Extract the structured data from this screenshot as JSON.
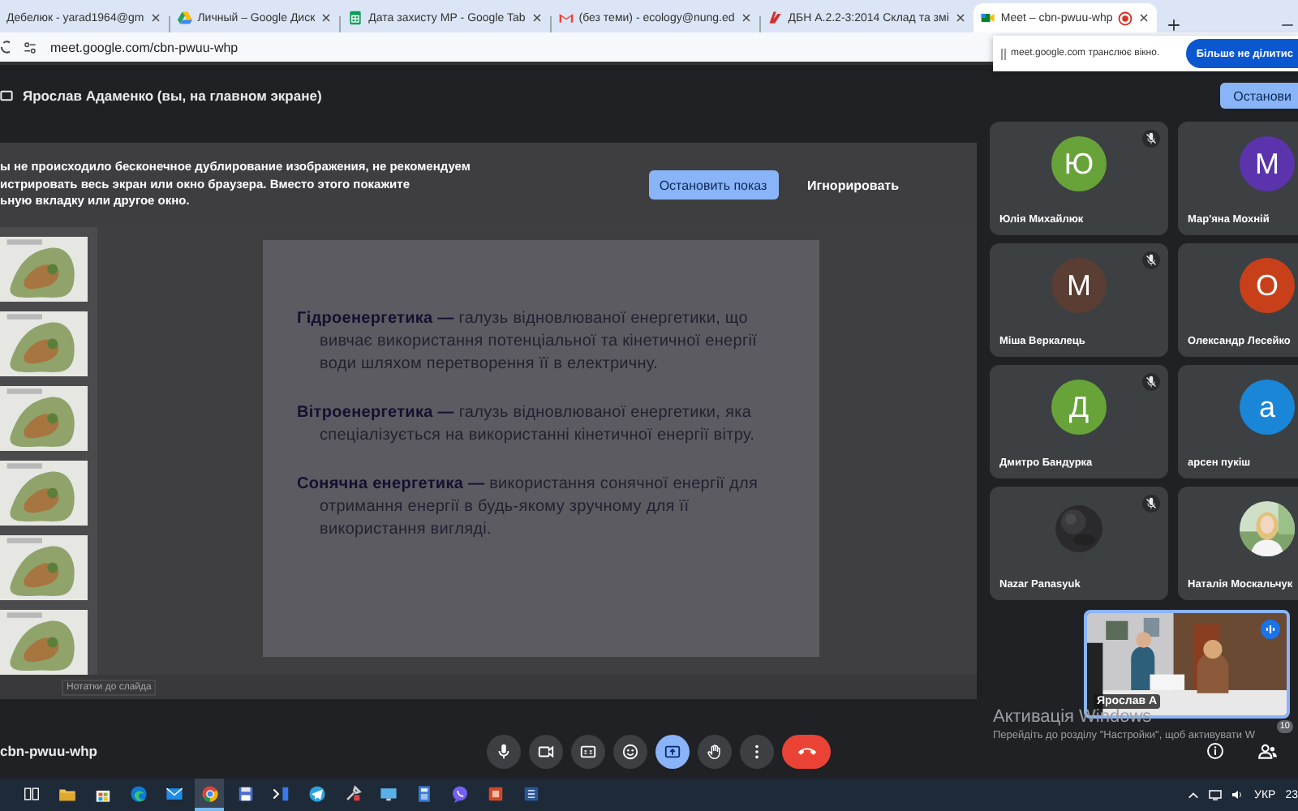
{
  "tabs": [
    {
      "title": "Дебелюк - yarad1964@gm",
      "kind": "plain",
      "selected": false
    },
    {
      "title": "Личный – Google Диск",
      "kind": "drive",
      "selected": false
    },
    {
      "title": "Дата захисту МР - Google Tab",
      "kind": "sheets",
      "selected": false
    },
    {
      "title": "(без теми) - ecology@nung.ed",
      "kind": "mail",
      "selected": false
    },
    {
      "title": "ДБН А.2.2-3:2014 Склад та змі",
      "kind": "emblem",
      "selected": false
    },
    {
      "title": "Meet – cbn-pwuu-whp",
      "kind": "meet",
      "selected": true,
      "recording": true
    }
  ],
  "address": {
    "url": "meet.google.com/cbn-pwuu-whp"
  },
  "share_popup": {
    "text": "meet.google.com транслює вікно.",
    "button": "Більше не ділитис"
  },
  "meet_header": {
    "presenter": "Ярослав Адаменко (вы, на главном экране)",
    "stop_button": "Останови"
  },
  "presentation": {
    "notice": {
      "text": "ы не происходило бесконечное дублирование изображения, не рекомендуем\nистрировать весь экран или окно браузера. Вместо этого покажите\nьную вкладку или другое окно.",
      "primary": "Остановить показ",
      "secondary": "Игнорировать"
    },
    "slide": {
      "paragraphs": [
        "**Гідроенергетика —** галузь відновлюваної енергетики, що вивчає використання потенціальної та кінетичної енергії води шляхом перетворення її в електричну.",
        "**Вітроенергетика —** галузь відновлюваної енергетики, яка спеціалізується на використанні кінетичної енергії вітру.",
        "**Сонячна енергетика —** використання сонячної енергії для отримання енергії в будь-якому зручному для її використання вигляді."
      ]
    },
    "notes": "Нотатки до слайда"
  },
  "participants": [
    {
      "name": "Юлія Михайлюк",
      "kind": "letter",
      "initial": "Ю",
      "color": "#68a33a",
      "muted": true
    },
    {
      "name": "Мар'яна Мохній",
      "kind": "letter",
      "initial": "М",
      "color": "#5b34ad"
    },
    {
      "name": "Міша Веркалець",
      "kind": "letter",
      "initial": "М",
      "color": "#5a3d33",
      "muted": true
    },
    {
      "name": "Олександр Лесейко",
      "kind": "letter",
      "initial": "О",
      "color": "#c8401a"
    },
    {
      "name": "Дмитро Бандурка",
      "kind": "letter",
      "initial": "Д",
      "color": "#68a33a",
      "muted": true
    },
    {
      "name": "арсен пукіш",
      "kind": "letter",
      "initial": "а",
      "color": "#1a86d8"
    },
    {
      "name": "Nazar Panasyuk",
      "kind": "picture",
      "muted": true
    },
    {
      "name": "Наталія Москальчук",
      "kind": "picture"
    }
  ],
  "self_view": {
    "name": "Ярослав А",
    "speaking": true
  },
  "meeting_code": "cbn-pwuu-whp",
  "controls": [
    {
      "kind": "mic",
      "selected": false
    },
    {
      "kind": "camera",
      "selected": false
    },
    {
      "kind": "captions",
      "selected": false
    },
    {
      "kind": "emoji",
      "selected": false
    },
    {
      "kind": "present",
      "selected": true
    },
    {
      "kind": "hand",
      "selected": false
    },
    {
      "kind": "more",
      "selected": false
    },
    {
      "kind": "leave",
      "selected": false
    }
  ],
  "participant_count": "10",
  "windows_notice": {
    "title": "Активація Windows",
    "text": "Перейдіть до розділу \"Настройки\", щоб активувати W"
  },
  "taskbar": {
    "apps": [
      {
        "kind": "taskview",
        "selected": false
      },
      {
        "kind": "folder",
        "selected": false
      },
      {
        "kind": "store",
        "selected": false
      },
      {
        "kind": "edge",
        "selected": false
      },
      {
        "kind": "mail",
        "selected": false
      },
      {
        "kind": "chrome",
        "selected": true
      },
      {
        "kind": "floppy",
        "selected": false
      },
      {
        "kind": "terminal",
        "selected": false
      },
      {
        "kind": "telegram",
        "selected": false
      },
      {
        "kind": "tool",
        "selected": false
      },
      {
        "kind": "screen",
        "selected": false
      },
      {
        "kind": "calculator",
        "selected": false
      },
      {
        "kind": "viber",
        "selected": false
      },
      {
        "kind": "slides",
        "selected": false
      },
      {
        "kind": "document",
        "selected": false
      }
    ],
    "language": "УКР",
    "clock": "23"
  }
}
